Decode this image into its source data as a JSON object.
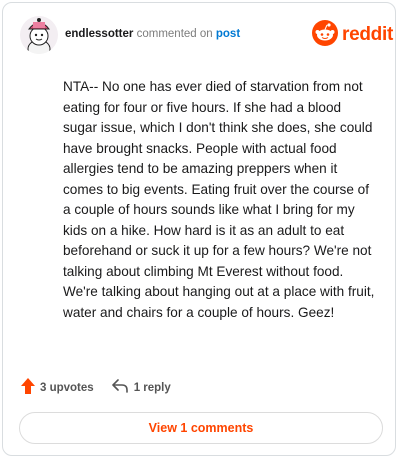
{
  "header": {
    "username": "endlessotter",
    "action": "commented on",
    "target": "post"
  },
  "logo": {
    "text": "reddit",
    "brand_color": "#ff4500"
  },
  "comment": {
    "text": "NTA-- No one has ever died of starvation from not eating for four or five hours. If she had a blood sugar issue, which I don't think she does, she could have brought snacks. People with actual food allergies tend to be amazing preppers when it comes to big events. Eating fruit over the course of a couple of hours sounds like what I bring for my kids on a hike. How hard is it as an adult to eat beforehand or suck it up for a few hours? We're not talking about climbing Mt Everest without food. We're talking about hanging out at a place with fruit, water and chairs for a couple of hours. Geez!"
  },
  "footer": {
    "upvotes": "3 upvotes",
    "replies": "1 reply"
  },
  "view_button": {
    "label": "View 1 comments"
  },
  "icons": {
    "upvote": "upvote-arrow-icon",
    "reply": "reply-arrow-icon",
    "logo": "reddit-snoo-icon"
  }
}
